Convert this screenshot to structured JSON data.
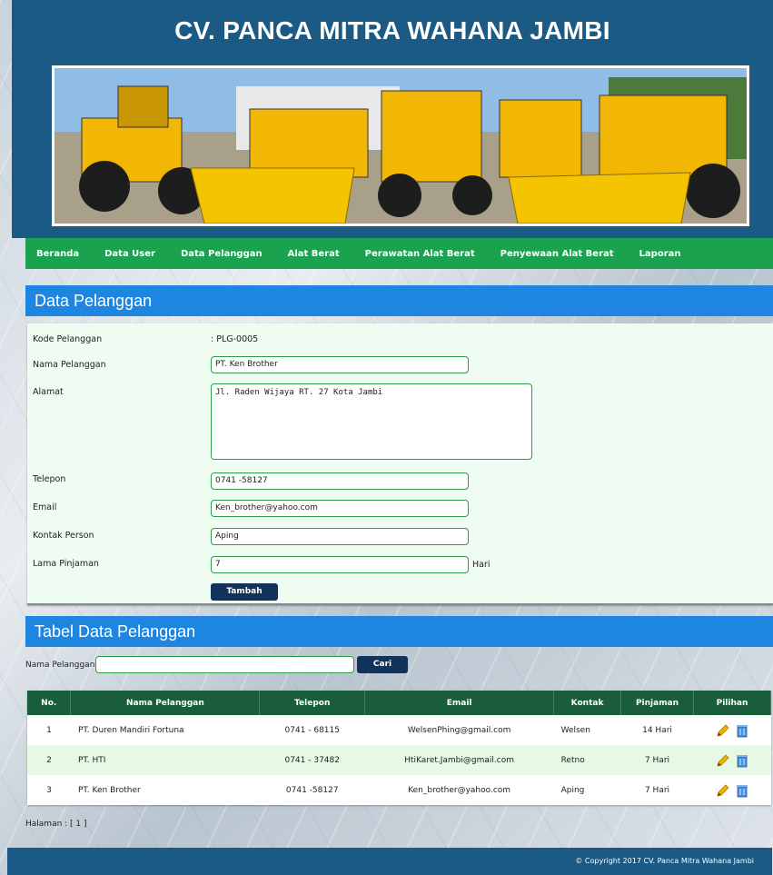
{
  "site": {
    "title": "CV. PANCA MITRA WAHANA JAMBI"
  },
  "nav": [
    "Beranda",
    "Data User",
    "Data Pelanggan",
    "Alat Berat",
    "Perawatan Alat Berat",
    "Penyewaan Alat Berat",
    "Laporan"
  ],
  "form": {
    "section_title": "Data Pelanggan",
    "kode_label": "Kode Pelanggan",
    "kode_value": ": PLG-0005",
    "nama_label": "Nama Pelanggan",
    "nama_value": "PT. Ken Brother",
    "alamat_label": "Alamat",
    "alamat_value": "Jl. Raden Wijaya RT. 27 Kota Jambi",
    "telepon_label": "Telepon",
    "telepon_value": "0741 -58127",
    "email_label": "Email",
    "email_value": "Ken_brother@yahoo.com",
    "kontak_label": "Kontak Person",
    "kontak_value": "Aping",
    "lama_label": "Lama Pinjaman",
    "lama_value": "7",
    "lama_unit": "Hari",
    "submit_label": "Tambah"
  },
  "table_section": {
    "title": "Tabel Data Pelanggan",
    "search_label": "Nama Pelanggan :",
    "search_value": "",
    "search_button": "Cari",
    "columns": [
      "No.",
      "Nama Pelanggan",
      "Telepon",
      "Email",
      "Kontak",
      "Pinjaman",
      "Pilihan"
    ],
    "rows": [
      [
        "1",
        "PT. Duren Mandiri Fortuna",
        "0741 - 68115",
        "WelsenPhing@gmail.com",
        "Welsen",
        "14 Hari"
      ],
      [
        "2",
        "PT. HTI",
        "0741 - 37482",
        "HtiKaret.Jambi@gmail.com",
        "Retno",
        "7 Hari"
      ],
      [
        "3",
        "PT. Ken Brother",
        "0741 -58127",
        "Ken_brother@yahoo.com",
        "Aping",
        "7 Hari"
      ]
    ],
    "pager": "Halaman : [ 1 ]"
  },
  "footer": {
    "copyright": "© Copyright 2017 CV. Panca Mitra Wahana Jambi"
  },
  "colors": {
    "header_blue": "#1b5a84",
    "nav_green": "#1aa24f",
    "section_blue": "#1e86e0",
    "table_header": "#1a5d3b",
    "button_navy": "#12325a"
  }
}
